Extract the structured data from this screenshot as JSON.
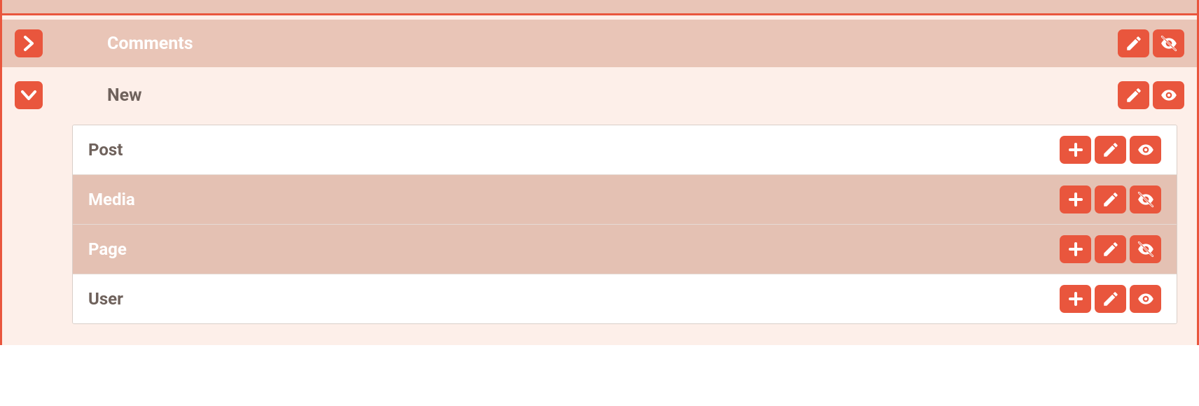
{
  "sections": {
    "comments": {
      "label": "Comments",
      "expanded": false,
      "visibility_hidden": true
    },
    "new": {
      "label": "New",
      "expanded": true,
      "visibility_hidden": false,
      "items": [
        {
          "label": "Post",
          "hidden": false
        },
        {
          "label": "Media",
          "hidden": true
        },
        {
          "label": "Page",
          "hidden": true
        },
        {
          "label": "User",
          "hidden": false
        }
      ]
    }
  }
}
